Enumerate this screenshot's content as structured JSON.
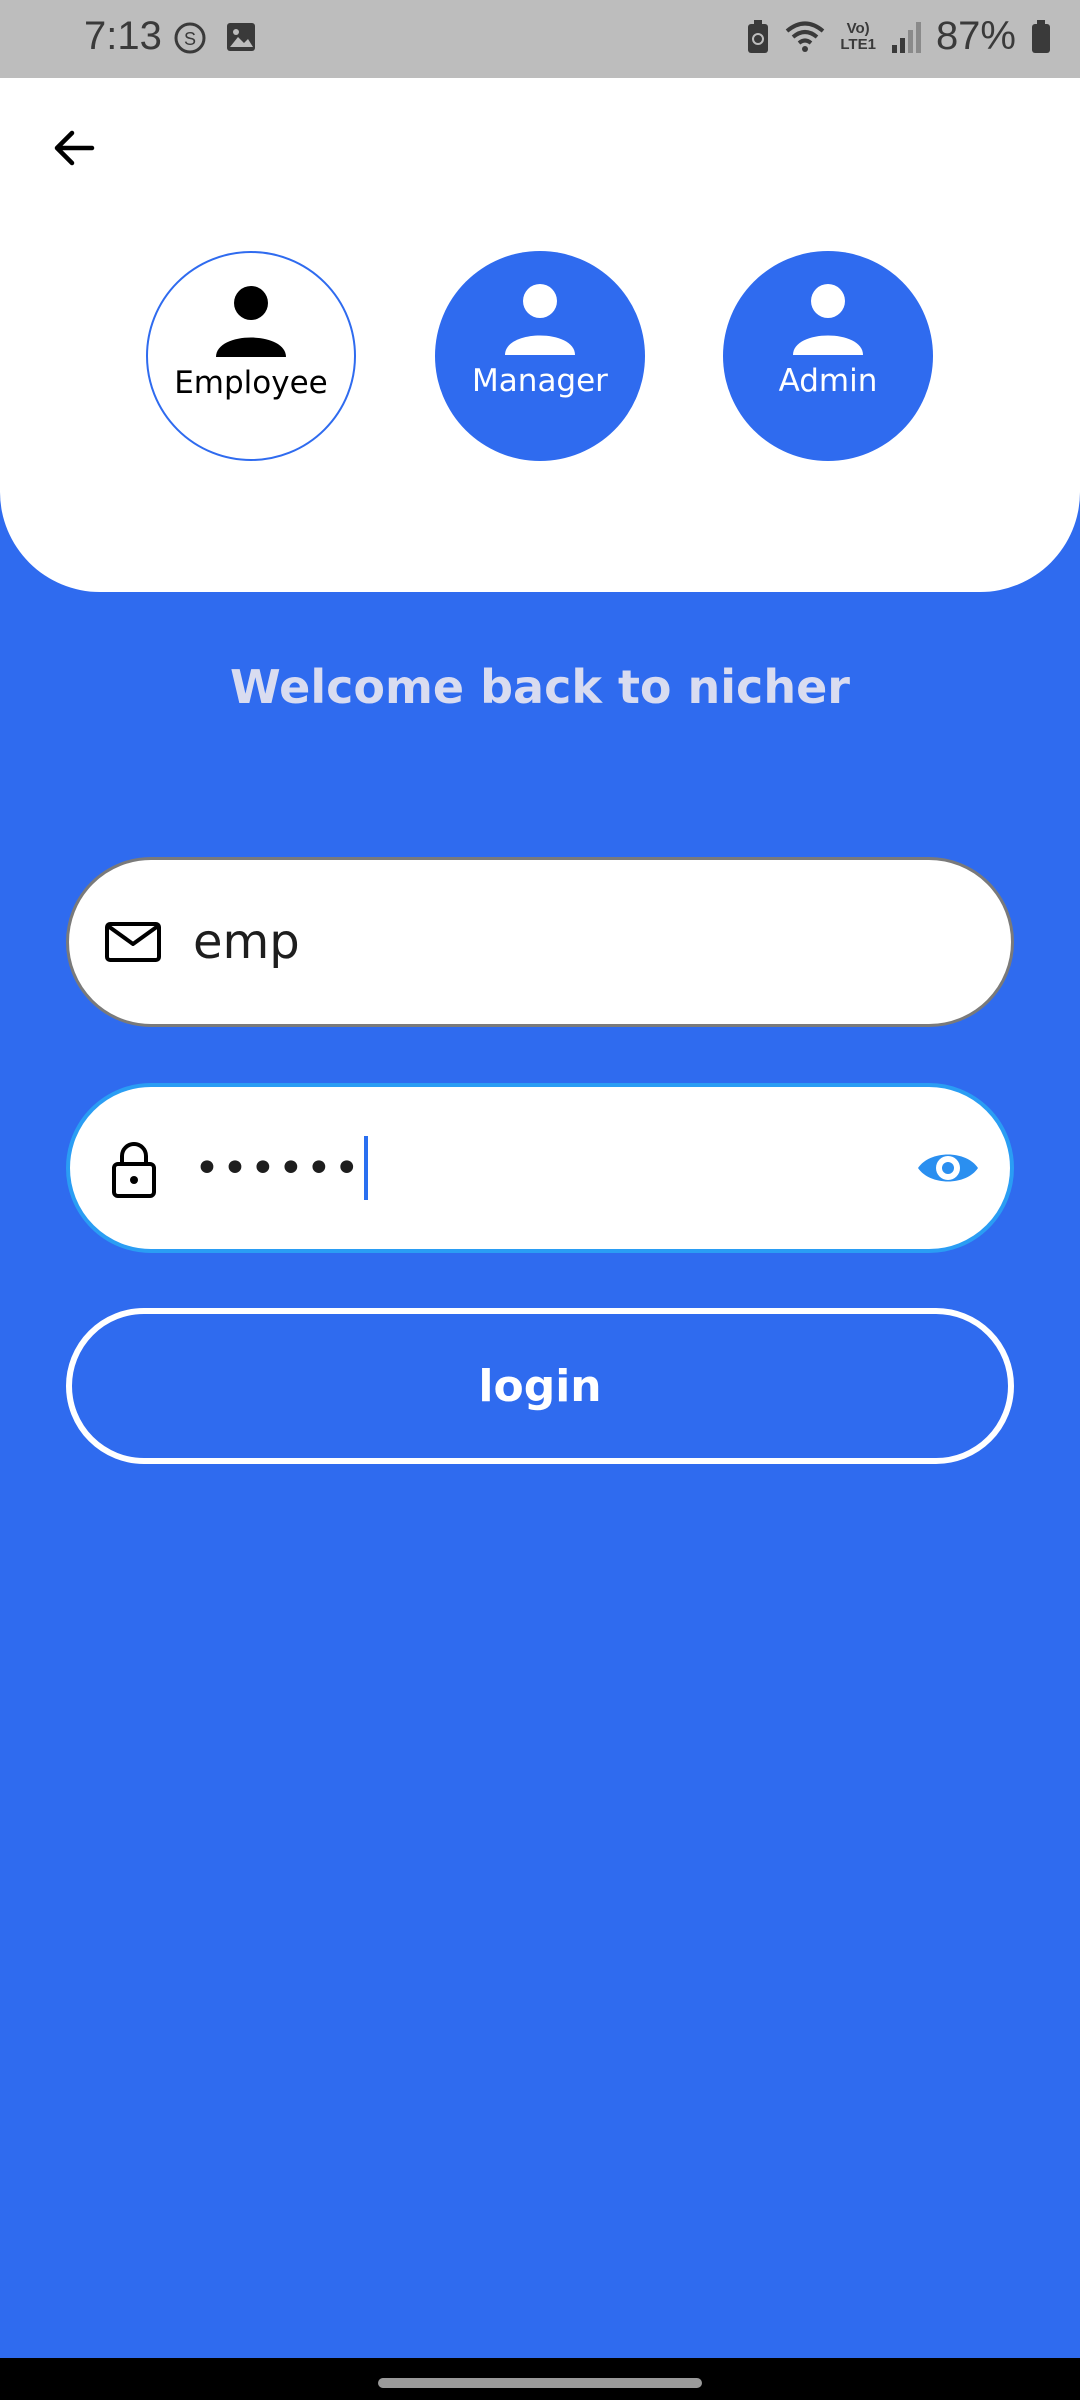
{
  "status_bar": {
    "time": "7:13",
    "battery_percent": "87%",
    "network_label_top": "Vo)",
    "network_label_bottom": "LTE1",
    "icons": [
      "sync-icon",
      "gallery-icon",
      "battery-saver-icon",
      "wifi-icon",
      "signal-icon",
      "battery-icon"
    ]
  },
  "header": {
    "back_icon": "arrow-left-icon"
  },
  "roles": [
    {
      "label": "Employee",
      "selected": true,
      "icon": "person-icon"
    },
    {
      "label": "Manager",
      "selected": false,
      "icon": "person-icon"
    },
    {
      "label": "Admin",
      "selected": false,
      "icon": "person-icon"
    }
  ],
  "welcome_text": "Welcome back to nicher",
  "form": {
    "email": {
      "value": "emp",
      "icon": "mail-icon"
    },
    "password": {
      "value": "••••••",
      "icon": "lock-icon",
      "toggle_icon": "eye-icon"
    },
    "login_label": "login"
  },
  "colors": {
    "primary": "#2f6bef",
    "focus_border": "#2a9df4",
    "welcome_text": "#d9dcf0"
  }
}
